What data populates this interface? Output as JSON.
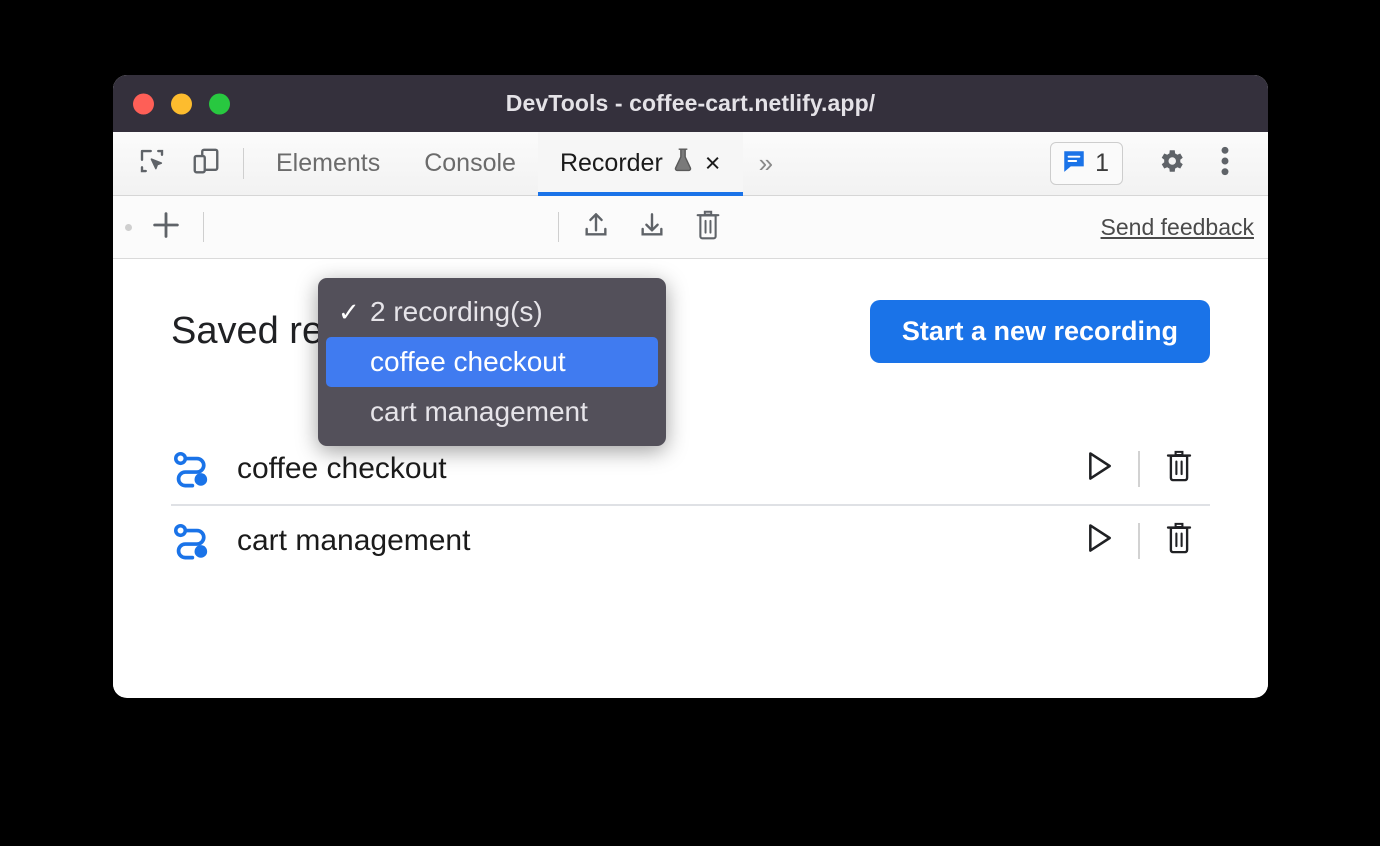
{
  "window": {
    "title": "DevTools - coffee-cart.netlify.app/",
    "traffic_lights": [
      "close",
      "minimize",
      "zoom"
    ],
    "colors": {
      "titlebar_bg": "#34303c",
      "accent_blue": "#1a73e8",
      "menu_bg": "#53505a",
      "menu_selected": "#407bf0"
    }
  },
  "tabbar": {
    "left_icons": [
      {
        "name": "inspect-element-icon",
        "label": "Inspect element"
      },
      {
        "name": "device-toolbar-icon",
        "label": "Toggle device toolbar"
      }
    ],
    "tabs": [
      {
        "label": "Elements",
        "active": false
      },
      {
        "label": "Console",
        "active": false
      },
      {
        "label": "Recorder",
        "active": true,
        "experimental": true,
        "closable": true
      }
    ],
    "more_tabs_label": "»",
    "close_label": "×",
    "issues": {
      "count": "1",
      "icon": "issues-message-icon"
    },
    "settings_icon": "gear-icon",
    "more_options_icon": "kebab-menu-icon"
  },
  "recorder_toolbar": {
    "add_label": "+",
    "add_icon": "plus-icon",
    "recordings_selector": "2 recording(s)",
    "import_icon": "upload-icon",
    "export_icon": "download-icon",
    "delete_icon": "trash-icon",
    "send_feedback": "Send feedback"
  },
  "dropdown": {
    "open": true,
    "items": [
      {
        "label": "2 recording(s)",
        "checked": true,
        "selected": false
      },
      {
        "label": "coffee checkout",
        "checked": false,
        "selected": true
      },
      {
        "label": "cart management",
        "checked": false,
        "selected": false
      }
    ],
    "check_glyph": "✓"
  },
  "panel": {
    "title": "Saved recordings",
    "start_button": "Start a new recording",
    "recordings": [
      {
        "name": "coffee checkout",
        "icon": "recording-flow-icon",
        "replay_icon": "play-icon",
        "delete_icon": "trash-icon"
      },
      {
        "name": "cart management",
        "icon": "recording-flow-icon",
        "replay_icon": "play-icon",
        "delete_icon": "trash-icon"
      }
    ]
  }
}
